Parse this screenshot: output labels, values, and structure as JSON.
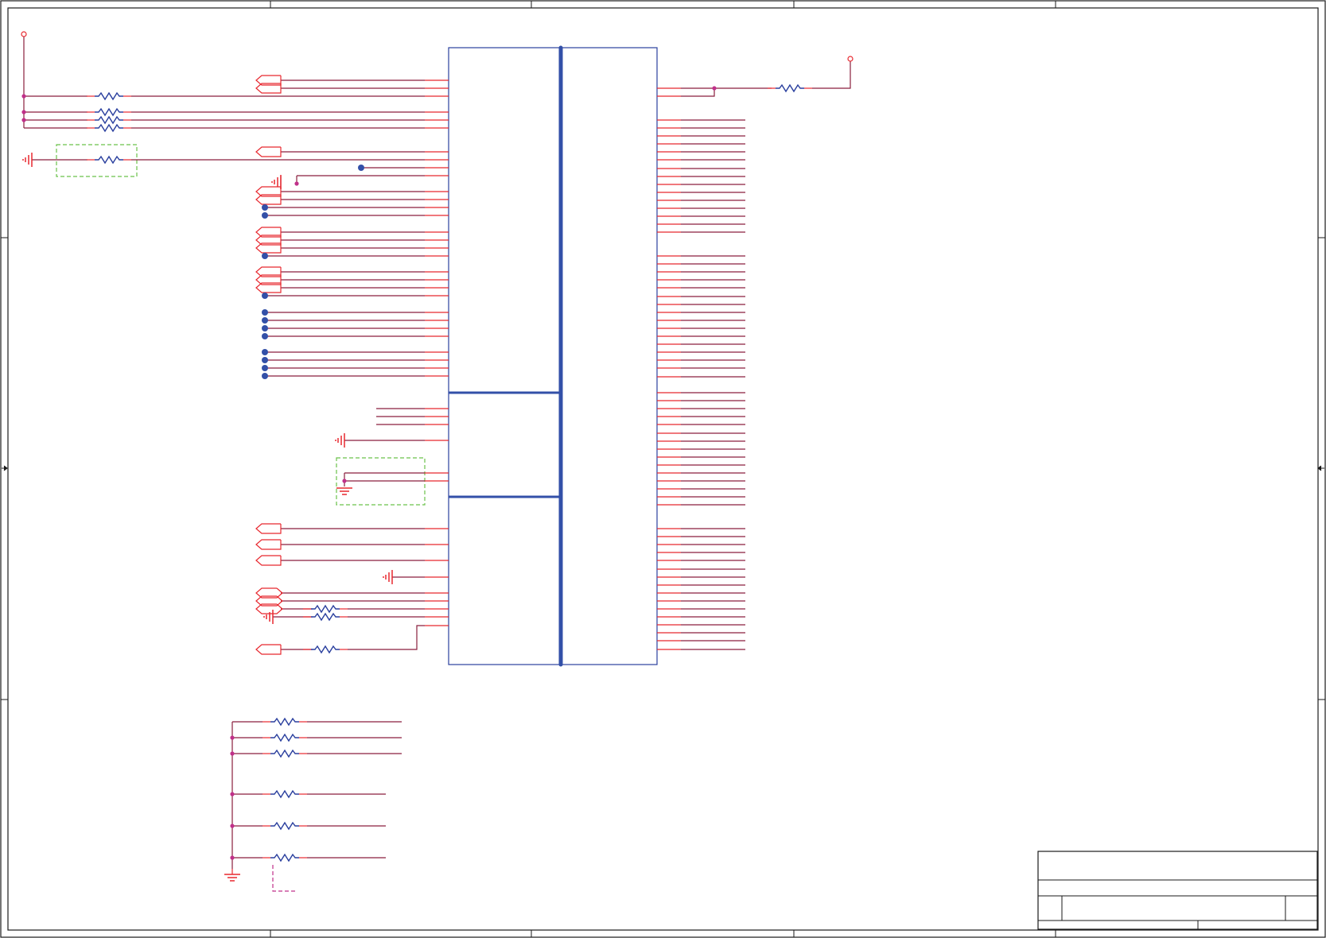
{
  "colors": {
    "background": "#ffffff",
    "frame": "#1a1a1a",
    "wire": "#8a1f3d",
    "pin_stub": "#e8282f",
    "component": "#e8282f",
    "resistor": "#2a3f9e",
    "chip_outline": "#2a3f9e",
    "bus": "#3350a8",
    "junction": "#c0308a",
    "no_connect": "#3350a8",
    "keepout_box": "#6ac24a"
  },
  "title_block": {}
}
